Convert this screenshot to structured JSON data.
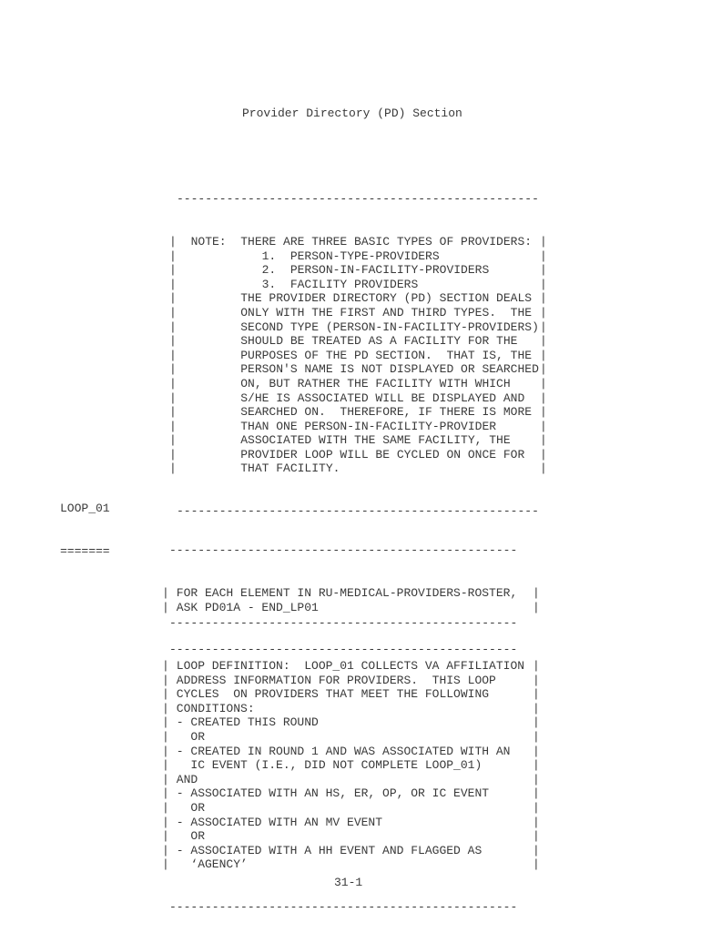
{
  "document": {
    "title": "Provider Directory (PD) Section",
    "page_number": "31-1"
  },
  "note_box": {
    "rule": "---------------------------------------------------",
    "lines": [
      "  NOTE:  THERE ARE THREE BASIC TYPES OF PROVIDERS:",
      "            1.  PERSON-TYPE-PROVIDERS",
      "            2.  PERSON-IN-FACILITY-PROVIDERS",
      "            3.  FACILITY PROVIDERS",
      "         THE PROVIDER DIRECTORY (PD) SECTION DEALS",
      "         ONLY WITH THE FIRST AND THIRD TYPES.  THE",
      "         SECOND TYPE (PERSON-IN-FACILITY-PROVIDERS)",
      "         SHOULD BE TREATED AS A FACILITY FOR THE",
      "         PURPOSES OF THE PD SECTION.  THAT IS, THE",
      "         PERSON'S NAME IS NOT DISPLAYED OR SEARCHED",
      "         ON, BUT RATHER THE FACILITY WITH WHICH",
      "         S/HE IS ASSOCIATED WILL BE DISPLAYED AND",
      "         SEARCHED ON.  THEREFORE, IF THERE IS MORE",
      "         THAN ONE PERSON-IN-FACILITY-PROVIDER",
      "         ASSOCIATED WITH THE SAME FACILITY, THE",
      "         PROVIDER LOOP WILL BE CYCLED ON ONCE FOR",
      "         THAT FACILITY."
    ]
  },
  "section": {
    "label": "LOOP_01",
    "underline": "======="
  },
  "loop_ask_box": {
    "rule": "-------------------------------------------------",
    "lines": [
      " FOR EACH ELEMENT IN RU-MEDICAL-PROVIDERS-ROSTER,",
      " ASK PD01A - END_LP01"
    ]
  },
  "loop_def_box": {
    "rule": "-------------------------------------------------",
    "lines": [
      " LOOP DEFINITION:  LOOP_01 COLLECTS VA AFFILIATION",
      " ADDRESS INFORMATION FOR PROVIDERS.  THIS LOOP",
      " CYCLES  ON PROVIDERS THAT MEET THE FOLLOWING",
      " CONDITIONS:",
      " - CREATED THIS ROUND",
      "   OR",
      " - CREATED IN ROUND 1 AND WAS ASSOCIATED WITH AN",
      "   IC EVENT (I.E., DID NOT COMPLETE LOOP_01)",
      " AND",
      " - ASSOCIATED WITH AN HS, ER, OP, OR IC EVENT",
      "   OR",
      " - ASSOCIATED WITH AN MV EVENT",
      "   OR",
      " - ASSOCIATED WITH A HH EVENT AND FLAGGED AS",
      "   ‘AGENCY’"
    ]
  },
  "glyphs": {
    "pipe": "|"
  },
  "colors": {
    "text": "#3a3a3a",
    "background": "#ffffff"
  }
}
